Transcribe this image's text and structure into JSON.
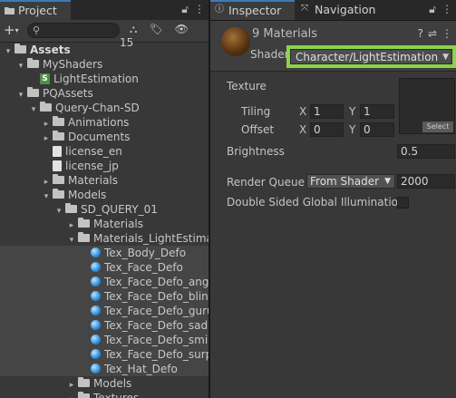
{
  "project": {
    "tab_label": "Project",
    "tab_icon": "folder-icon",
    "hidden_count": "15",
    "tree": [
      {
        "label": "Assets",
        "depth": 0,
        "arrow": "▾",
        "icon": "folder",
        "bold": true
      },
      {
        "label": "MyShaders",
        "depth": 1,
        "arrow": "▾",
        "icon": "folder"
      },
      {
        "label": "LightEstimation",
        "depth": 2,
        "arrow": "",
        "icon": "shader"
      },
      {
        "label": "PQAssets",
        "depth": 1,
        "arrow": "▾",
        "icon": "folder"
      },
      {
        "label": "Query-Chan-SD",
        "depth": 2,
        "arrow": "▾",
        "icon": "folder"
      },
      {
        "label": "Animations",
        "depth": 3,
        "arrow": "▸",
        "icon": "folder"
      },
      {
        "label": "Documents",
        "depth": 3,
        "arrow": "▸",
        "icon": "folder"
      },
      {
        "label": "license_en",
        "depth": 3,
        "arrow": "",
        "icon": "file"
      },
      {
        "label": "license_jp",
        "depth": 3,
        "arrow": "",
        "icon": "file"
      },
      {
        "label": "Materials",
        "depth": 3,
        "arrow": "▸",
        "icon": "folder"
      },
      {
        "label": "Models",
        "depth": 3,
        "arrow": "▾",
        "icon": "folder"
      },
      {
        "label": "SD_QUERY_01",
        "depth": 4,
        "arrow": "▾",
        "icon": "folder"
      },
      {
        "label": "Materials",
        "depth": 5,
        "arrow": "▸",
        "icon": "folder"
      },
      {
        "label": "Materials_LightEstima",
        "depth": 5,
        "arrow": "▾",
        "icon": "folder"
      },
      {
        "label": "Tex_Body_Defo",
        "depth": 6,
        "arrow": "",
        "icon": "material",
        "selected": true
      },
      {
        "label": "Tex_Face_Defo",
        "depth": 6,
        "arrow": "",
        "icon": "material",
        "selected": true
      },
      {
        "label": "Tex_Face_Defo_ang",
        "depth": 6,
        "arrow": "",
        "icon": "material",
        "selected": true
      },
      {
        "label": "Tex_Face_Defo_blin",
        "depth": 6,
        "arrow": "",
        "icon": "material",
        "selected": true
      },
      {
        "label": "Tex_Face_Defo_guru",
        "depth": 6,
        "arrow": "",
        "icon": "material",
        "selected": true
      },
      {
        "label": "Tex_Face_Defo_sad",
        "depth": 6,
        "arrow": "",
        "icon": "material",
        "selected": true
      },
      {
        "label": "Tex_Face_Defo_smi",
        "depth": 6,
        "arrow": "",
        "icon": "material",
        "selected": true
      },
      {
        "label": "Tex_Face_Defo_surp",
        "depth": 6,
        "arrow": "",
        "icon": "material",
        "selected": true
      },
      {
        "label": "Tex_Hat_Defo",
        "depth": 6,
        "arrow": "",
        "icon": "material",
        "selected": true
      },
      {
        "label": "Models",
        "depth": 5,
        "arrow": "▸",
        "icon": "folder"
      },
      {
        "label": "Textures",
        "depth": 5,
        "arrow": "▸",
        "icon": "folder"
      }
    ]
  },
  "inspector": {
    "tab_label": "Inspector",
    "nav_tab_label": "Navigation",
    "title": "9 Materials",
    "shader_label": "Shader",
    "shader_value": "Character/LightEstimation",
    "texture_label": "Texture",
    "tiling_label": "Tiling",
    "offset_label": "Offset",
    "x_label": "X",
    "y_label": "Y",
    "tiling_x": "1",
    "tiling_y": "1",
    "offset_x": "0",
    "offset_y": "0",
    "select_label": "Select",
    "brightness_label": "Brightness",
    "brightness_value": "0.5",
    "render_queue_label": "Render Queue",
    "render_queue_mode": "From Shader",
    "render_queue_value": "2000",
    "dsgi_label": "Double Sided Global Illumination"
  },
  "colors": {
    "highlight": "#8ad44a",
    "tab_accent": "#3a79bb",
    "material_icon": "#2a8ddb"
  }
}
